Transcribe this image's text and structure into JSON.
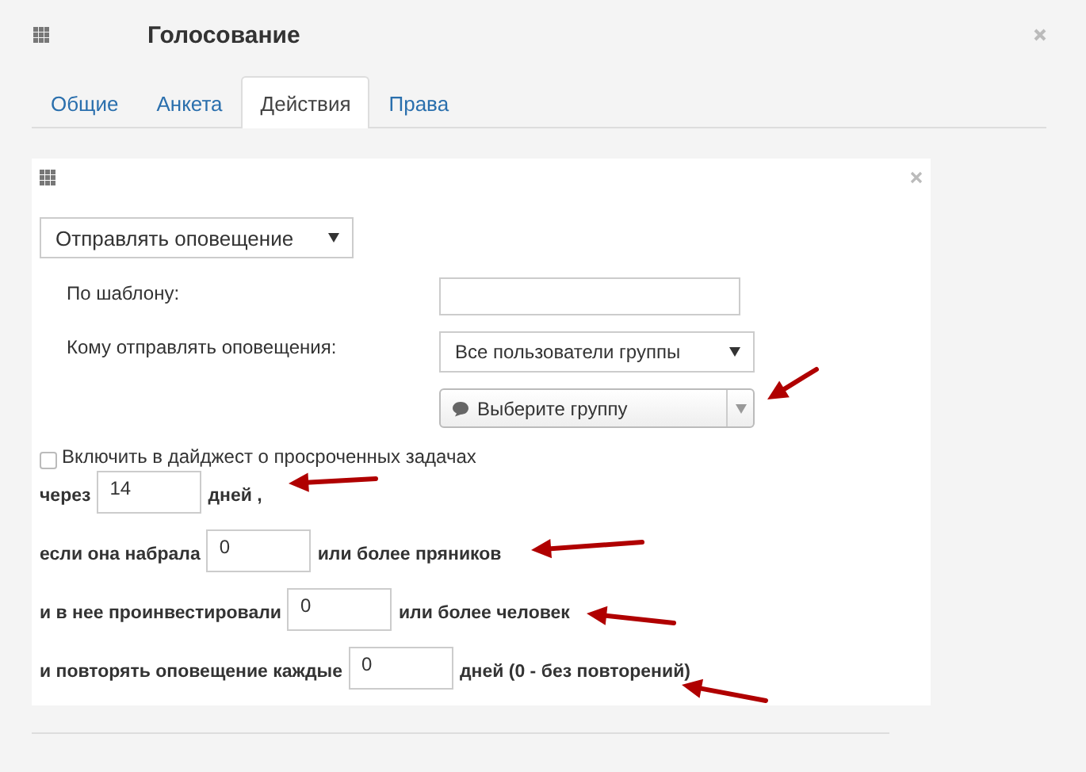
{
  "window": {
    "title": "Голосование"
  },
  "tabs": [
    {
      "label": "Общие",
      "selected": false
    },
    {
      "label": "Анкета",
      "selected": false
    },
    {
      "label": "Действия",
      "selected": true
    },
    {
      "label": "Права",
      "selected": false
    }
  ],
  "action": {
    "select": "Отправлять оповещение",
    "template": {
      "label": "По шаблону:"
    },
    "recipients": {
      "label": "Кому отправлять оповещения:",
      "select": "Все пользователи группы"
    },
    "group_select": "Выберите группу",
    "digest": {
      "label": "Включить в дайджест о просроченных задачах",
      "checked": false
    },
    "conditions": [
      {
        "prefix": "через",
        "value": "14",
        "suffix": "дней ,"
      },
      {
        "prefix": "если она набрала",
        "value": "0",
        "suffix": "или более пряников"
      },
      {
        "prefix": "и в нее проинвестировали",
        "value": "0",
        "suffix": "или более человек"
      },
      {
        "prefix": "и повторять оповещение каждые",
        "value": "0",
        "suffix": "дней (0 - без повторений)"
      }
    ]
  }
}
